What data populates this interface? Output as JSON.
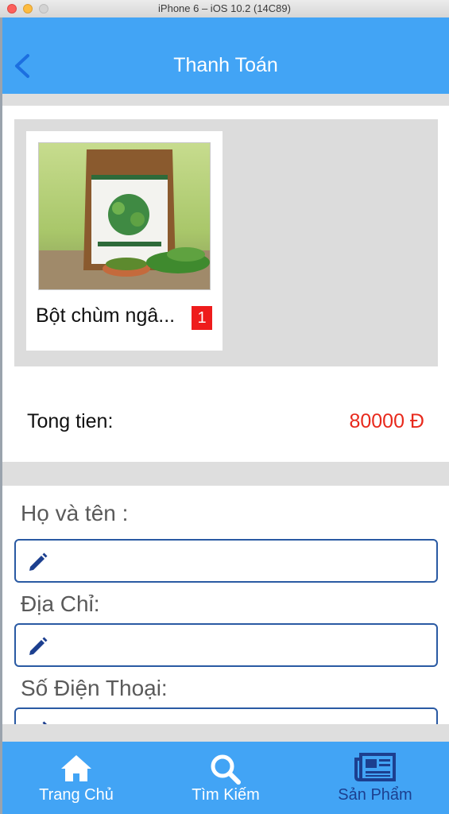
{
  "window": {
    "title": "iPhone 6 – iOS 10.2 (14C89)"
  },
  "navbar": {
    "title": "Thanh Toán",
    "back_icon": "chevron-left-icon"
  },
  "product": {
    "name": "Bột chùm ngâ...",
    "quantity": "1",
    "image": "moringa-powder-bag-photo"
  },
  "total": {
    "label": "Tong tien:",
    "value": "80000 Đ"
  },
  "form": {
    "name_label": "Họ và tên :",
    "name_value": "",
    "address_label": "Địa Chỉ:",
    "address_value": "",
    "phone_label": "Số Điện Thoại:",
    "phone_value": ""
  },
  "tabbar": {
    "items": [
      {
        "label": "Trang Chủ",
        "icon": "home-icon",
        "active": false
      },
      {
        "label": "Tìm Kiếm",
        "icon": "search-icon",
        "active": false
      },
      {
        "label": "Sản Phẩm",
        "icon": "newspaper-icon",
        "active": true
      }
    ]
  },
  "colors": {
    "accent": "#42a4f5",
    "price": "#e8291c",
    "active_tab": "#1c3f8f",
    "field_border": "#2a5aa3"
  }
}
